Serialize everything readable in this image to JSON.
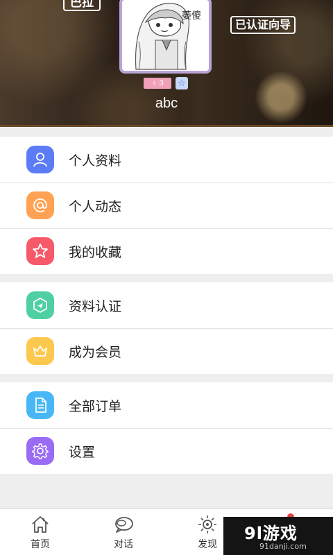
{
  "header": {
    "top_left_tag": "巴拉",
    "verify_tag": "已认证向导",
    "avatar_caption": "萎傻",
    "gender_badge": "♀ 3",
    "star_badge": "☆",
    "username": "abc"
  },
  "menu": {
    "group1": [
      {
        "label": "个人资料",
        "icon": "user-icon",
        "color": "#5b7cf5"
      },
      {
        "label": "个人动态",
        "icon": "at-icon",
        "color": "#ffa254"
      },
      {
        "label": "我的收藏",
        "icon": "star-icon",
        "color": "#f5596a"
      }
    ],
    "group2": [
      {
        "label": "资料认证",
        "icon": "verify-shield-icon",
        "color": "#4fd0a3"
      },
      {
        "label": "成为会员",
        "icon": "crown-icon",
        "color": "#fcc84d"
      }
    ],
    "group3": [
      {
        "label": "全部订单",
        "icon": "document-icon",
        "color": "#47b8f5"
      },
      {
        "label": "设置",
        "icon": "gear-icon",
        "color": "#9a6cf3"
      }
    ]
  },
  "tabbar": {
    "home": "首页",
    "chat": "对话",
    "discover": "发现"
  },
  "watermark": {
    "logo": "9l游戏",
    "sub": "91danji.com"
  }
}
